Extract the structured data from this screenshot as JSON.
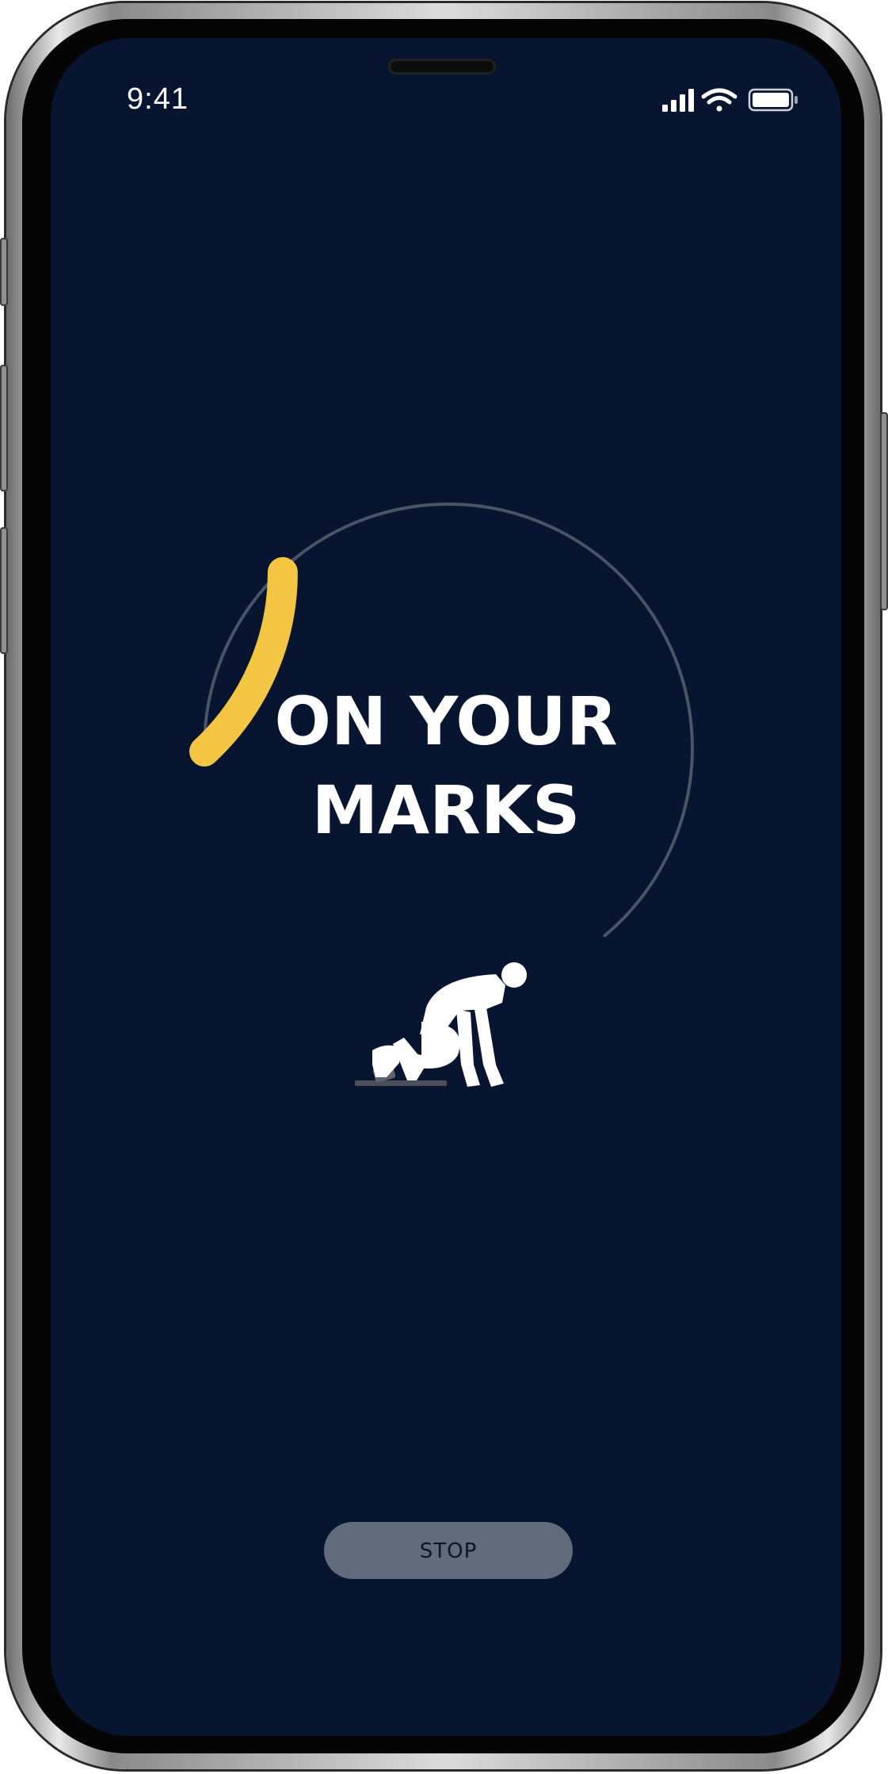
{
  "status_bar": {
    "time": "9:41",
    "icons": [
      "cellular-signal-icon",
      "wifi-icon",
      "battery-icon"
    ]
  },
  "countdown": {
    "title_line1": "ON YOUR",
    "title_line2": "MARKS",
    "progress_fraction": 0.15,
    "icon": "sprinter-crouch-icon"
  },
  "controls": {
    "stop_label": "STOP"
  },
  "colors": {
    "background": "#081530",
    "progress_accent": "#F4C543",
    "ring_track": "#4A5466",
    "button_bg": "#626B7B"
  }
}
